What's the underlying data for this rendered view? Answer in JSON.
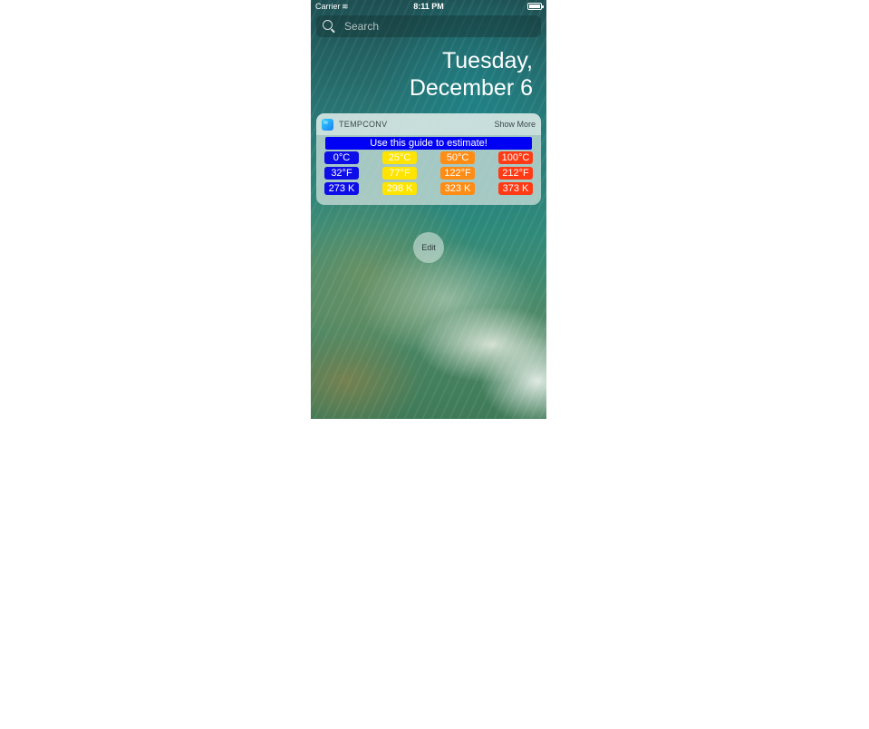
{
  "status_bar": {
    "carrier": "Carrier",
    "wifi_icon": "wifi-icon",
    "time": "8:11 PM",
    "battery_icon": "battery-icon"
  },
  "search": {
    "placeholder": "Search"
  },
  "date": {
    "line1": "Tuesday,",
    "line2": "December 6"
  },
  "widget": {
    "app_name": "TEMPCONV",
    "show_more": "Show More",
    "guide_text": "Use this guide to estimate!",
    "rows": [
      [
        "0°C",
        "25°C",
        "50°C",
        "100°C"
      ],
      [
        "32°F",
        "77°F",
        "122°F",
        "212°F"
      ],
      [
        "273 K",
        "298 K",
        "323 K",
        "373 K"
      ]
    ],
    "colors": [
      "#0d0de8",
      "#ffe400",
      "#ff8c14",
      "#ff3a14"
    ]
  },
  "edit_label": "Edit"
}
